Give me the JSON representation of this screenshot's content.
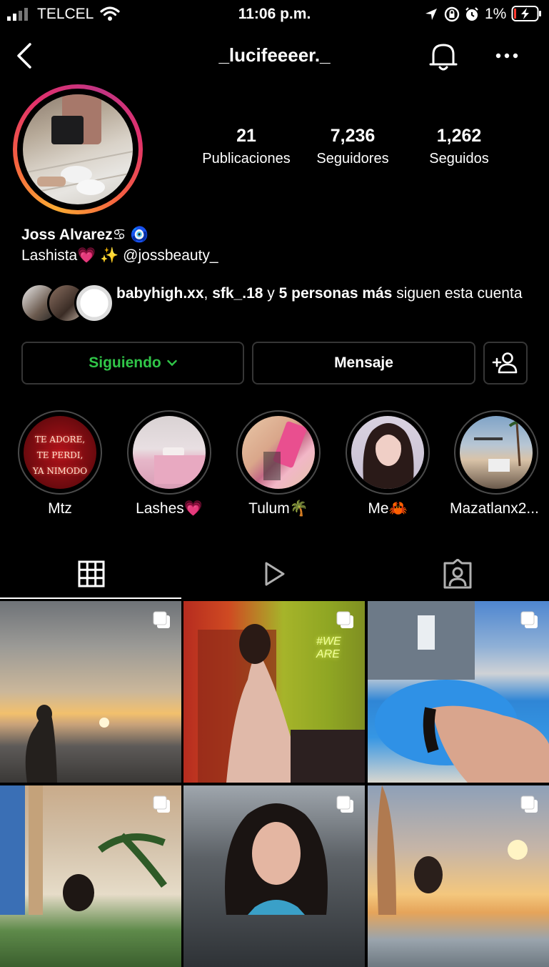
{
  "status_bar": {
    "carrier": "TELCEL",
    "time": "11:06 p.m.",
    "battery": "1%"
  },
  "nav": {
    "username": "_lucifeeeer._"
  },
  "profile": {
    "stats": [
      {
        "num": "21",
        "label": "Publicaciones"
      },
      {
        "num": "7,236",
        "label": "Seguidores"
      },
      {
        "num": "1,262",
        "label": "Seguidos"
      }
    ],
    "name": "Joss Alvarez♋ 🧿",
    "bio": "Lashista💗 ✨ @jossbeauty_",
    "followed_by": {
      "user1": "babyhigh.xx",
      "sep": ", ",
      "user2": "sfk_.18",
      "connector": " y ",
      "others": "5 personas más",
      "suffix": " siguen esta cuenta"
    }
  },
  "buttons": {
    "following": "Siguiendo",
    "message": "Mensaje"
  },
  "highlights": [
    {
      "label": "Mtz",
      "overlay": [
        "TE ADORE,",
        "TE PERDI,",
        "YA NIMODO"
      ]
    },
    {
      "label": "Lashes💗"
    },
    {
      "label": "Tulum🌴"
    },
    {
      "label": "Me🦀"
    },
    {
      "label": "Mazatlanx2..."
    }
  ],
  "icons": {
    "back": "chevron-left-icon",
    "bell": "bell-icon",
    "more": "more-horizontal-icon",
    "grid": "grid-icon",
    "reels": "play-icon",
    "tagged": "tagged-icon",
    "add_user": "add-user-icon"
  },
  "colors": {
    "following_green": "#30c648",
    "background": "#000000",
    "border": "#363636"
  },
  "grid": {
    "row2_col2_text": "#WE ARE"
  }
}
